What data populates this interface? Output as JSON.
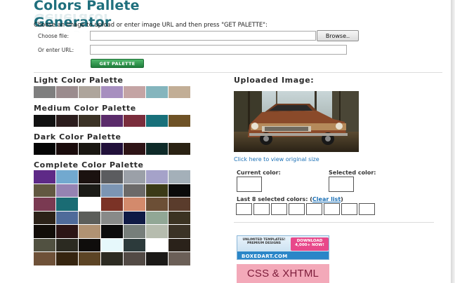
{
  "header": {
    "title": "Colors Pallete Generator",
    "intro": "Choose an image to upload or enter image URL and then press \"GET PALETTE\":"
  },
  "form": {
    "choose_file_label": "Choose file:",
    "browse_label": "Browse..",
    "url_label": "Or enter URL:",
    "url_value": "",
    "get_palette_label": "GET PALETTE"
  },
  "palettes": {
    "light": {
      "title": "Light Color Palette",
      "colors": [
        "#7f7f7f",
        "#9b8c8e",
        "#aea59c",
        "#a78fbf",
        "#c4a4a4",
        "#84b5bd",
        "#c2ae96"
      ]
    },
    "medium": {
      "title": "Medium Color Palette",
      "colors": [
        "#111111",
        "#2a1c1c",
        "#3b3226",
        "#5a2b6a",
        "#7a2d3c",
        "#18707a",
        "#6e5226"
      ]
    },
    "dark": {
      "title": "Dark Color Palette",
      "colors": [
        "#050505",
        "#190b0b",
        "#1a1712",
        "#21103a",
        "#2e1416",
        "#0e2a28",
        "#2a2213"
      ]
    },
    "complete": {
      "title": "Complete Color Palette",
      "colors": [
        "#5e2a87",
        "#72a9cf",
        "#1b1210",
        "#5b5c5f",
        "#9ba0a8",
        "#a5a2c9",
        "#a4b0b9",
        "#625841",
        "#9583b2",
        "#1b1b17",
        "#7c95b3",
        "#6c6a69",
        "#3b3a17",
        "#0a0a0a",
        "#7a3a52",
        "#1a6c74",
        "#ffffff",
        "#7b3326",
        "#d38a6c",
        "#6c4f36",
        "#5a3c2c",
        "#2c2218",
        "#4f6b9a",
        "#5c5e5a",
        "#888a89",
        "#0f1a45",
        "#91a795",
        "#3b3322",
        "#120d08",
        "#2c1515",
        "#b09273",
        "#0c0c0c",
        "#767e7a",
        "#b6bcae",
        "#3b3326",
        "#515141",
        "#2b2a21",
        "#0f0d0c",
        "#e6f8fb",
        "#2c3a3b",
        "#ffffff",
        "#2a221a",
        "#6e5138",
        "#35240f",
        "#5c4425",
        "#2d2b22",
        "#524a45",
        "#1b1917",
        "#6b5f57"
      ]
    }
  },
  "uploaded": {
    "title": "Uploaded Image:",
    "view_original_link": "Click here to view original size"
  },
  "selection": {
    "current_label": "Current color:",
    "selected_label": "Selected color:",
    "last8_label": "Last 8 selected colors: (",
    "clear_list_label": "Clear list",
    "last8_close": ")"
  },
  "ads": {
    "ad1_left": "UNLIMITED TEMPLATES! PREMIUM DESIGNS",
    "ad1_right": "DOWNLOAD 4,000+ NOW!",
    "ad1_brand": "BOXEDART.COM",
    "ad2_text": "CSS & XHTML"
  }
}
